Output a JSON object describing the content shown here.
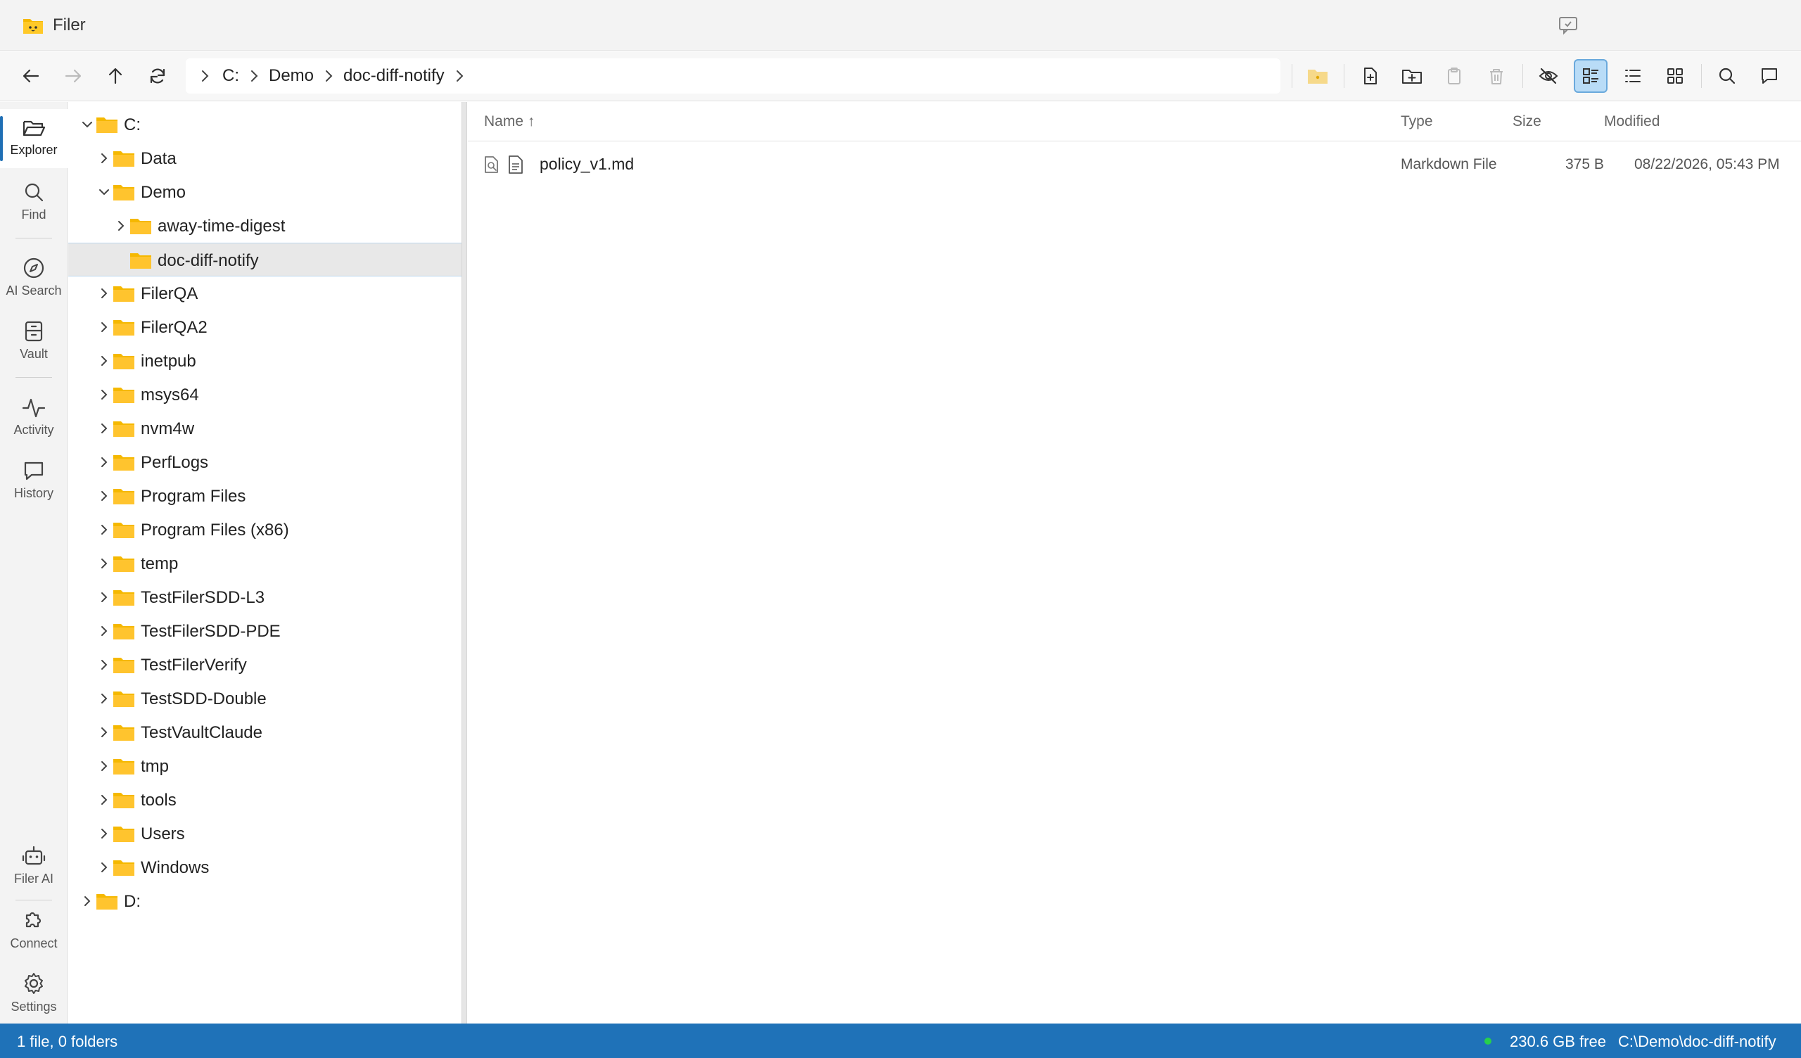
{
  "app": {
    "title": "Filer"
  },
  "breadcrumb": {
    "items": [
      "C:",
      "Demo",
      "doc-diff-notify"
    ]
  },
  "nav": {
    "items": [
      {
        "label": "Explorer",
        "icon": "folder-open-icon"
      },
      {
        "label": "Find",
        "icon": "search-icon"
      },
      {
        "label": "AI Search",
        "icon": "compass-icon"
      },
      {
        "label": "Vault",
        "icon": "vault-icon"
      },
      {
        "label": "Activity",
        "icon": "activity-icon"
      },
      {
        "label": "History",
        "icon": "chat-icon"
      },
      {
        "label": "Filer AI",
        "icon": "robot-icon"
      },
      {
        "label": "Connect",
        "icon": "puzzle-icon"
      },
      {
        "label": "Settings",
        "icon": "gear-icon"
      }
    ]
  },
  "tree": {
    "items": [
      {
        "label": "C:",
        "depth": 0,
        "expanded": true
      },
      {
        "label": "Data",
        "depth": 1,
        "expanded": false
      },
      {
        "label": "Demo",
        "depth": 1,
        "expanded": true
      },
      {
        "label": "away-time-digest",
        "depth": 2,
        "expanded": false
      },
      {
        "label": "doc-diff-notify",
        "depth": 2,
        "selected": true,
        "leaf": true
      },
      {
        "label": "FilerQA",
        "depth": 1
      },
      {
        "label": "FilerQA2",
        "depth": 1
      },
      {
        "label": "inetpub",
        "depth": 1
      },
      {
        "label": "msys64",
        "depth": 1
      },
      {
        "label": "nvm4w",
        "depth": 1
      },
      {
        "label": "PerfLogs",
        "depth": 1
      },
      {
        "label": "Program Files",
        "depth": 1
      },
      {
        "label": "Program Files (x86)",
        "depth": 1
      },
      {
        "label": "temp",
        "depth": 1
      },
      {
        "label": "TestFilerSDD-L3",
        "depth": 1
      },
      {
        "label": "TestFilerSDD-PDE",
        "depth": 1
      },
      {
        "label": "TestFilerVerify",
        "depth": 1
      },
      {
        "label": "TestSDD-Double",
        "depth": 1
      },
      {
        "label": "TestVaultClaude",
        "depth": 1
      },
      {
        "label": "tmp",
        "depth": 1
      },
      {
        "label": "tools",
        "depth": 1
      },
      {
        "label": "Users",
        "depth": 1
      },
      {
        "label": "Windows",
        "depth": 1
      },
      {
        "label": "D:",
        "depth": 0
      }
    ]
  },
  "filelist": {
    "columns": {
      "name": "Name ↑",
      "type": "Type",
      "size": "Size",
      "modified": "Modified"
    },
    "rows": [
      {
        "name": "policy_v1.md",
        "type": "Markdown File",
        "size": "375 B",
        "modified": "08/22/2026, 05:43 PM"
      }
    ]
  },
  "status": {
    "summary": "1 file, 0 folders",
    "free": "230.6 GB free",
    "path": "C:\\Demo\\doc-diff-notify"
  },
  "colors": {
    "accent": "#1f72b8",
    "folder": "#f5b800",
    "active_view": "#b9dcf7"
  }
}
